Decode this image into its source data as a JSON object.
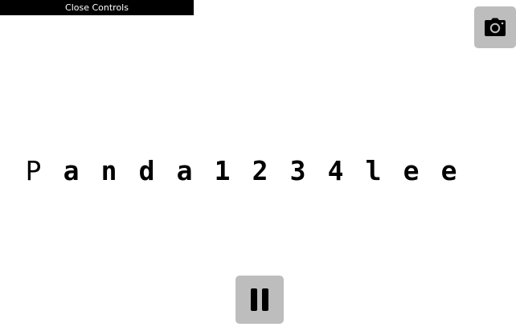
{
  "controls": {
    "close_label": "Close Controls"
  },
  "icons": {
    "camera": "camera-icon",
    "pause": "pause-icon"
  },
  "colors": {
    "button_bg": "#bdbdbd",
    "bar_bg": "#000000",
    "text": "#000000"
  },
  "sequence": {
    "typed_count": 1,
    "characters": [
      "P",
      "a",
      "n",
      "d",
      "a",
      "1",
      "2",
      "3",
      "4",
      "l",
      "e",
      "e"
    ]
  }
}
